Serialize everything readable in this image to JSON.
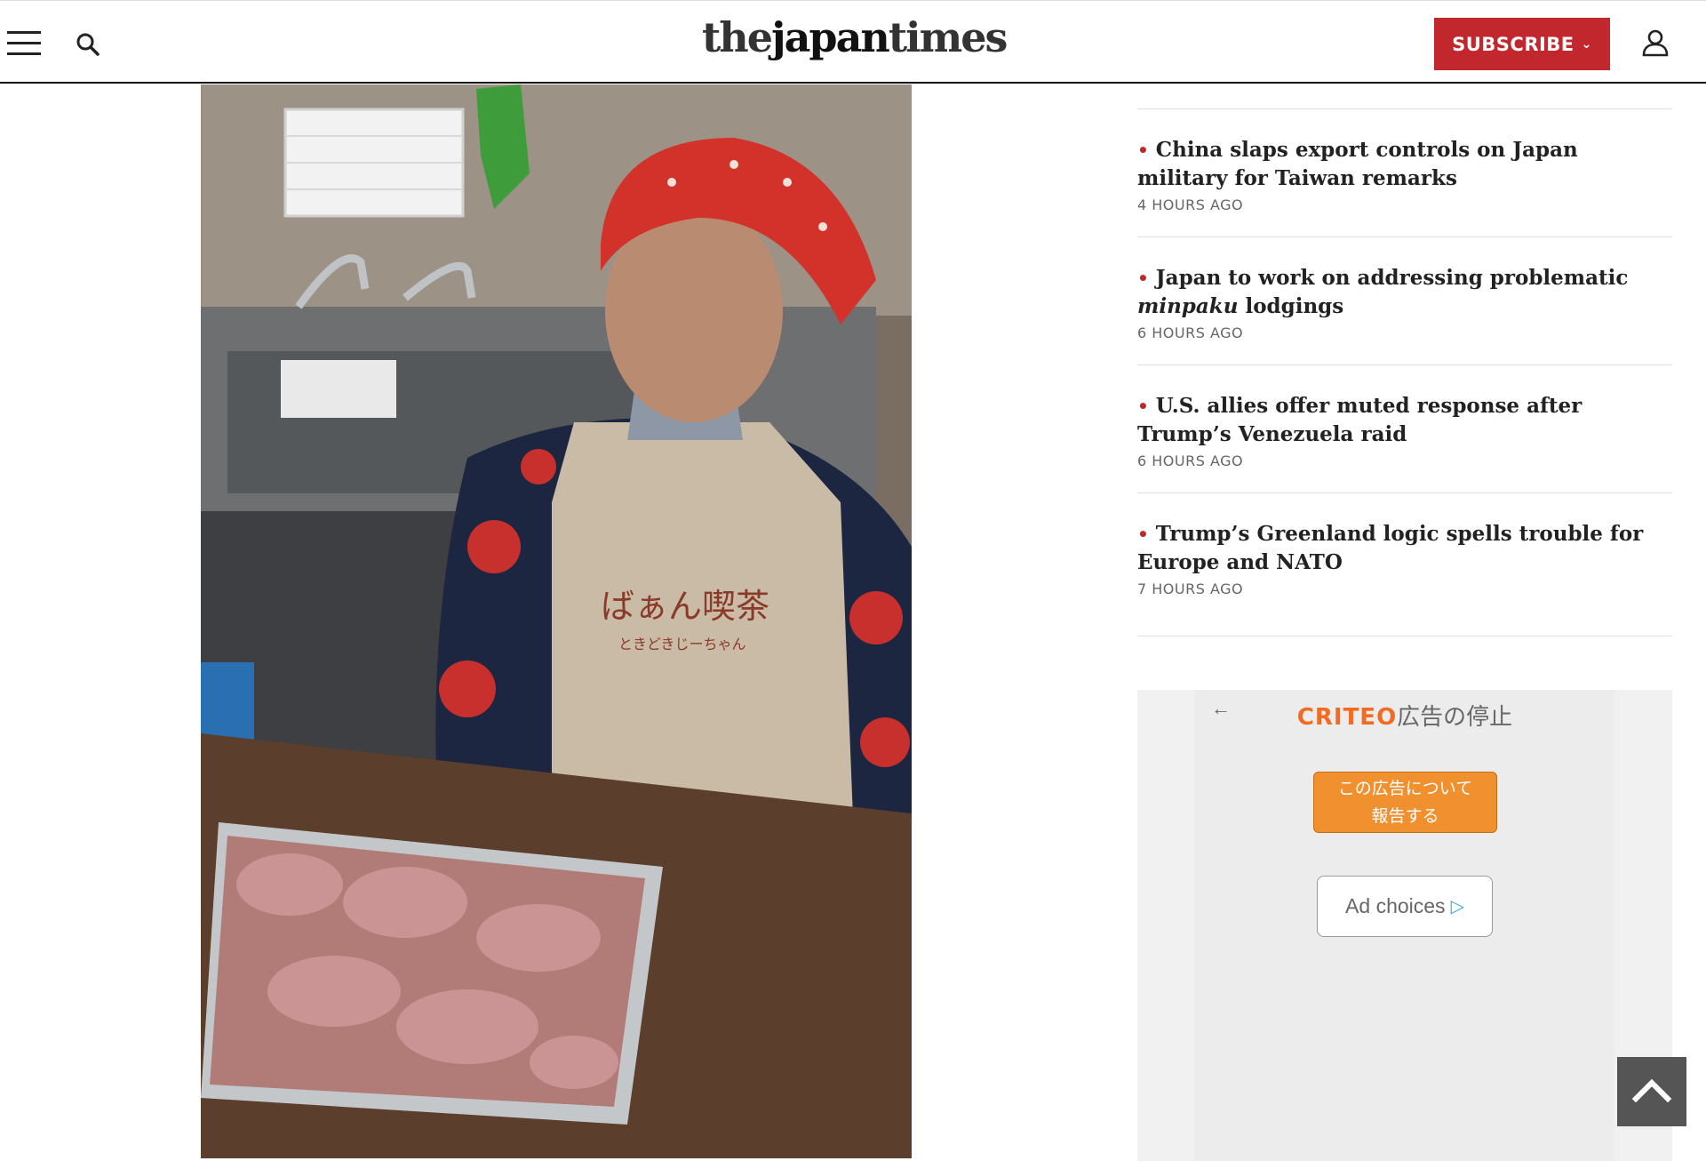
{
  "header": {
    "logo_the": "the",
    "logo_japan": "japan",
    "logo_times": "times",
    "subscribe_label": "SUBSCRIBE",
    "subscribe_chevron": "⌄",
    "menu_icon": "hamburger-menu-icon",
    "search_icon": "search-icon",
    "account_icon": "user-account-icon"
  },
  "photo": {
    "apron_text": "ばぁん喫茶",
    "apron_subtext": "ときどきじーちゃん"
  },
  "sidebar": {
    "items": [
      {
        "title": "China slaps export controls on Japan military for Taiwan remarks",
        "time": "4 HOURS AGO"
      },
      {
        "title_pre": "Japan to work on addressing problematic ",
        "title_em": "minpaku",
        "title_post": " lodgings",
        "time": "6 HOURS AGO"
      },
      {
        "title": "U.S. allies offer muted response after Trump’s Venezuela raid",
        "time": "6 HOURS AGO"
      },
      {
        "title": "Trump’s Greenland logic spells trouble for Europe and NATO",
        "time": "7 HOURS AGO"
      }
    ],
    "bullet": "•"
  },
  "ad": {
    "back_arrow": "←",
    "brand": "CRITEO",
    "brand_suffix": "広告の停止",
    "report_line1": "この広告について",
    "report_line2": "報告する",
    "choices_label": "Ad choices",
    "choices_icon": "▷"
  },
  "colors": {
    "accent": "#c1272d",
    "criteo_orange": "#f26b21",
    "report_button": "#f0902e"
  }
}
